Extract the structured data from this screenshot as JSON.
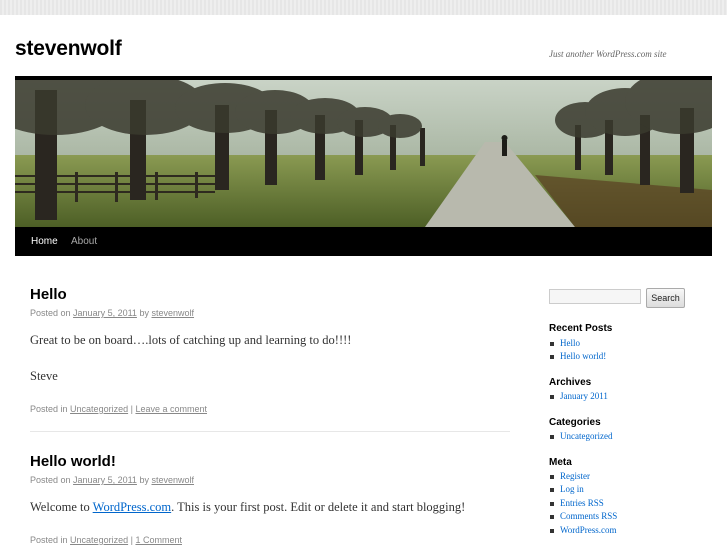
{
  "site": {
    "title": "stevenwolf",
    "description": "Just another WordPress.com site"
  },
  "nav": {
    "items": [
      {
        "label": "Home",
        "active": true
      },
      {
        "label": "About",
        "active": false
      }
    ]
  },
  "posts": [
    {
      "title": "Hello",
      "meta": {
        "posted_on": "Posted on",
        "date": "January 5, 2011",
        "by": "by",
        "author": "stevenwolf"
      },
      "paragraphs": [
        "Great to be on board….lots of catching up and learning to do!!!!",
        "Steve"
      ],
      "utility": {
        "posted_in": "Posted in",
        "category": "Uncategorized",
        "sep": "|",
        "comments": "Leave a comment"
      }
    },
    {
      "title": "Hello world!",
      "meta": {
        "posted_on": "Posted on",
        "date": "January 5, 2011",
        "by": "by",
        "author": "stevenwolf"
      },
      "body": {
        "before": "Welcome to ",
        "link": "WordPress.com",
        "after": ". This is your first post. Edit or delete it and start blogging!"
      },
      "utility": {
        "posted_in": "Posted in",
        "category": "Uncategorized",
        "sep": "|",
        "comments": "1 Comment"
      }
    }
  ],
  "sidebar": {
    "search": {
      "value": "",
      "button_label": "Search"
    },
    "recent_posts": {
      "title": "Recent Posts",
      "items": [
        "Hello",
        "Hello world!"
      ]
    },
    "archives": {
      "title": "Archives",
      "items": [
        "January 2011"
      ]
    },
    "categories": {
      "title": "Categories",
      "items": [
        "Uncategorized"
      ]
    },
    "meta": {
      "title": "Meta",
      "items": [
        "Register",
        "Log in",
        "Entries RSS",
        "Comments RSS",
        "WordPress.com"
      ]
    }
  },
  "colors": {
    "link": "#0066cc",
    "nav_bg": "#000000",
    "meta_text": "#888888"
  }
}
